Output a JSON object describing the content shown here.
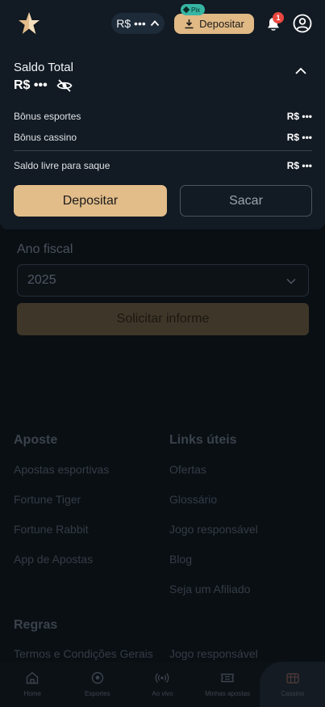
{
  "header": {
    "balance_pill": "R$ •••",
    "pix_badge": "Pix",
    "deposit_label": "Depositar",
    "notification_count": "1"
  },
  "panel": {
    "saldo_label": "Saldo Total",
    "saldo_value": "R$ •••",
    "rows": [
      {
        "label": "Bônus esportes",
        "value": "R$ •••"
      },
      {
        "label": "Bônus cassino",
        "value": "R$ •••"
      },
      {
        "label": "Saldo livre para saque",
        "value": "R$ •••"
      }
    ],
    "deposit_button": "Depositar",
    "withdraw_button": "Sacar"
  },
  "fiscal": {
    "label": "Ano fiscal",
    "year": "2025",
    "request_button": "Solicitar informe"
  },
  "footer": {
    "aposte": {
      "title": "Aposte",
      "links": [
        "Apostas esportivas",
        "Fortune Tiger",
        "Fortune Rabbit",
        "App de Apostas"
      ]
    },
    "links_uteis": {
      "title": "Links úteis",
      "links": [
        "Ofertas",
        "Glossário",
        "Jogo responsável",
        "Blog",
        "Seja um Afiliado"
      ]
    },
    "regras": {
      "title": "Regras",
      "links": [
        "Termos e Condições Gerais",
        "Jogo responsável"
      ]
    }
  },
  "bottom_nav": [
    {
      "label": "Home",
      "icon": "home-icon"
    },
    {
      "label": "Esportes",
      "icon": "ball-icon"
    },
    {
      "label": "Ao vivo",
      "icon": "live-icon"
    },
    {
      "label": "Minhas apostas",
      "icon": "ticket-icon"
    },
    {
      "label": "Cassino",
      "icon": "casino-icon"
    }
  ],
  "colors": {
    "accent_gold": "#e2bc89",
    "panel_bg": "#121a23",
    "page_bg": "#0a0f14",
    "pix_teal": "#36b5a3",
    "badge_red": "#e8473f"
  }
}
